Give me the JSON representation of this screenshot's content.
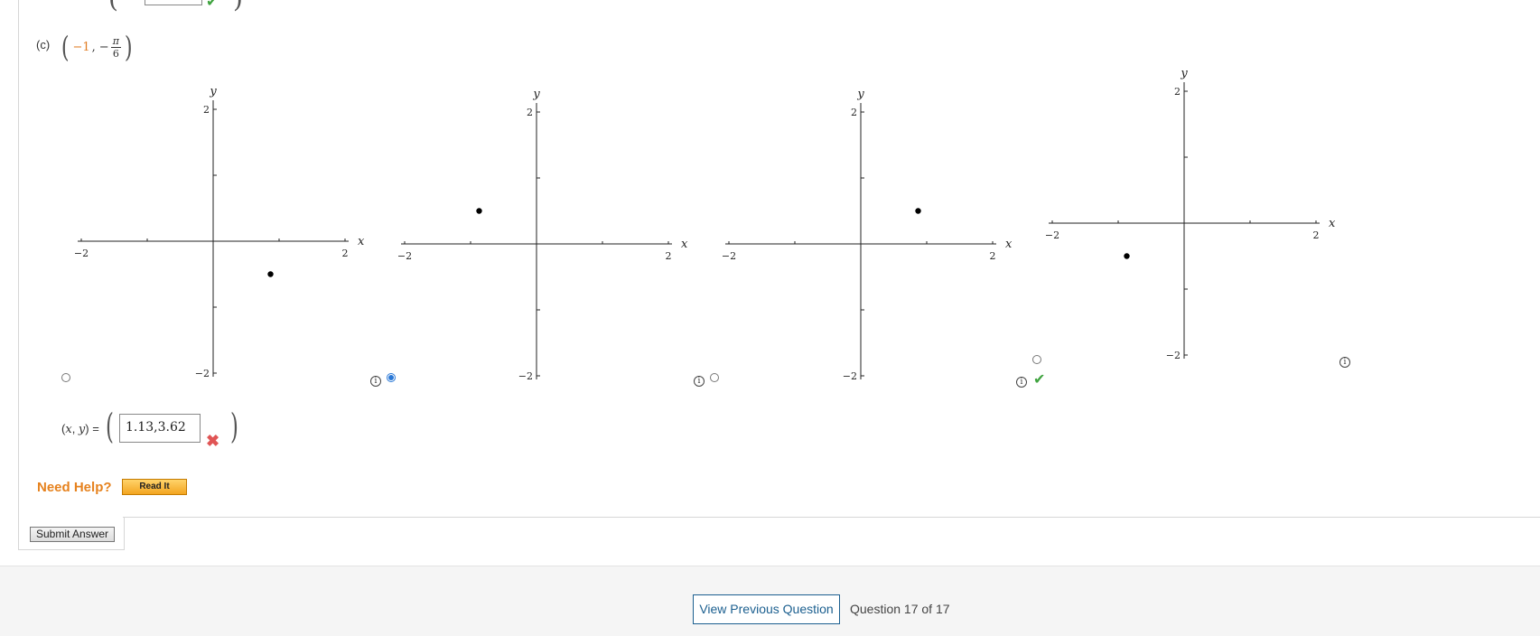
{
  "part": {
    "label": "(c)",
    "point_r": "−1",
    "point_sep": ",",
    "point_minus": "−",
    "theta_num": "π",
    "theta_den": "6"
  },
  "options": [
    {
      "id": "option-a",
      "point": [
        0.87,
        -0.5
      ],
      "x_ticks": [
        "−2",
        "2"
      ],
      "y_ticks": [
        "2",
        "−2"
      ],
      "x_label": "x",
      "y_label": "y",
      "selected": false,
      "info": "",
      "check": false
    },
    {
      "id": "option-b",
      "point": [
        -0.87,
        0.5
      ],
      "x_ticks": [
        "−2",
        "2"
      ],
      "y_ticks": [
        "2",
        "−2"
      ],
      "x_label": "x",
      "y_label": "y",
      "selected": true,
      "info": "i",
      "check": false
    },
    {
      "id": "option-c",
      "point": [
        0.87,
        0.5
      ],
      "x_ticks": [
        "−2",
        "2"
      ],
      "y_ticks": [
        "2",
        "−2"
      ],
      "x_label": "x",
      "y_label": "y",
      "selected": false,
      "info": "i",
      "check": false
    },
    {
      "id": "option-d",
      "point": [
        -0.87,
        -0.5
      ],
      "x_ticks": [
        "−2",
        "2"
      ],
      "y_ticks": [
        "2",
        "−2"
      ],
      "x_label": "x",
      "y_label": "y",
      "selected": false,
      "info": "i",
      "check": true
    }
  ],
  "answer": {
    "label_open": "(",
    "label_x": "x",
    "label_comma": ", ",
    "label_y": "y",
    "label_close": ") =",
    "value": "1.13,3.62",
    "status": "incorrect"
  },
  "help": {
    "title": "Need Help?",
    "read_it": "Read It"
  },
  "submit_label": "Submit Answer",
  "footer": {
    "prev_button": "View Previous Question",
    "question_counter": "Question 17 of 17"
  },
  "icons": {
    "check": "check-icon",
    "cross": "x-mark-icon",
    "info": "info-icon"
  },
  "colors": {
    "accent_orange": "#e6821e",
    "radio_blue": "#2a78d6",
    "correct_green": "#3fa33f",
    "incorrect_red": "#e05555",
    "link_blue": "#1b5f8f"
  }
}
